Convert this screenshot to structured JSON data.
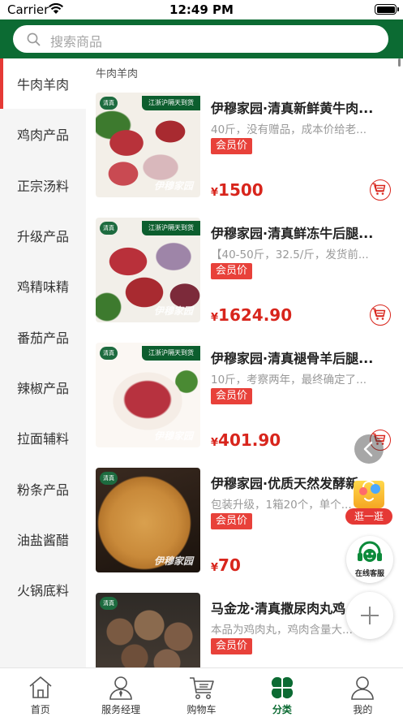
{
  "status_bar": {
    "carrier": "Carrier",
    "time": "12:49 PM"
  },
  "search": {
    "placeholder": "搜索商品",
    "icon": "search-icon"
  },
  "sidebar": {
    "active_index": 0,
    "items": [
      {
        "label": "牛肉羊肉"
      },
      {
        "label": "鸡肉产品"
      },
      {
        "label": "正宗汤料"
      },
      {
        "label": "升级产品"
      },
      {
        "label": "鸡精味精"
      },
      {
        "label": "番茄产品"
      },
      {
        "label": "辣椒产品"
      },
      {
        "label": "拉面辅料"
      },
      {
        "label": "粉条产品"
      },
      {
        "label": "油盐酱醋"
      },
      {
        "label": "火锅底料"
      }
    ]
  },
  "main": {
    "category_title": "牛肉羊肉",
    "products": [
      {
        "name": "伊穆家园·清真新鲜黄牛肉...",
        "desc": "40斤，没有赠品，成本价给老...",
        "tag": "会员价",
        "currency": "¥",
        "price": "1500",
        "badge": "清真",
        "ribbon": "江浙沪隔天到货",
        "watermark": "伊穆家园"
      },
      {
        "name": "伊穆家园·清真鲜冻牛后腿...",
        "desc": "【40-50斤，32.5/斤，发货前...",
        "tag": "会员价",
        "currency": "¥",
        "price": "1624.90",
        "badge": "清真",
        "ribbon": "江浙沪隔天到货",
        "watermark": "伊穆家园"
      },
      {
        "name": "伊穆家园·清真褪骨羊后腿...",
        "desc": "10斤，考察两年，最终确定了...",
        "tag": "会员价",
        "currency": "¥",
        "price": "401.90",
        "badge": "清真",
        "ribbon": "江浙沪隔天到货",
        "watermark": "伊穆家园"
      },
      {
        "name": "伊穆家园·优质天然发酵新...",
        "desc": "包装升级，1箱20个，单个...",
        "tag": "会员价",
        "currency": "¥",
        "price": "70",
        "badge": "清真",
        "ribbon": "",
        "watermark": "伊穆家园"
      },
      {
        "name": "马金龙·清真撒尿肉丸鸡...",
        "desc": "本品为鸡肉丸，鸡肉含量大...",
        "tag": "会员价",
        "currency": "",
        "price": "",
        "badge": "清真",
        "ribbon": "",
        "watermark": ""
      }
    ]
  },
  "floating": {
    "shop_label": "逛一逛",
    "service_label": "在线客服"
  },
  "tabbar": {
    "active_index": 3,
    "items": [
      {
        "label": "首页",
        "icon": "home-icon"
      },
      {
        "label": "服务经理",
        "icon": "manager-icon"
      },
      {
        "label": "购物车",
        "icon": "cart-icon"
      },
      {
        "label": "分类",
        "icon": "category-icon"
      },
      {
        "label": "我的",
        "icon": "profile-icon"
      }
    ]
  },
  "colors": {
    "brand_green": "#0c6b33",
    "accent_red": "#d8251c",
    "tag_red": "#e8413a"
  }
}
